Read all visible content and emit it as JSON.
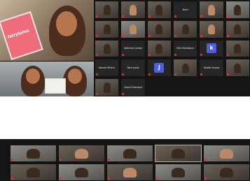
{
  "colors": {
    "tile_background": "#262626",
    "active_speaker_border": "#8fd14f",
    "avatar_blue": "#4e5ee0",
    "avatar_magenta": "#c93ad0"
  },
  "shot1": {
    "speaker_panel": {
      "book_title": "fairytales",
      "icon": "presenter-video"
    },
    "tiles": [
      {
        "type": "video",
        "name": "",
        "label": ""
      },
      {
        "type": "video",
        "name": "",
        "label": ""
      },
      {
        "type": "video",
        "name": "",
        "label": ""
      },
      {
        "type": "name",
        "name": "Neel",
        "label": ""
      },
      {
        "type": "video",
        "name": "",
        "label": ""
      },
      {
        "type": "video2",
        "name": "",
        "label": ""
      },
      {
        "type": "video",
        "name": "",
        "label": ""
      },
      {
        "type": "video2",
        "name": "",
        "label": ""
      },
      {
        "type": "video",
        "name": "",
        "label": ""
      },
      {
        "type": "video",
        "name": "",
        "label": ""
      },
      {
        "type": "video",
        "name": "",
        "label": ""
      },
      {
        "type": "video",
        "name": "",
        "label": ""
      },
      {
        "type": "video",
        "name": "",
        "label": ""
      },
      {
        "type": "name",
        "name": "Vaibhavi Jadav",
        "label": ""
      },
      {
        "type": "video",
        "name": "",
        "label": ""
      },
      {
        "type": "name",
        "name": "Mini Sarbajan",
        "label": ""
      },
      {
        "type": "avatar",
        "letter": "k",
        "color": "#4e5ee0",
        "label": ""
      },
      {
        "type": "video",
        "name": "",
        "label": ""
      },
      {
        "type": "name",
        "name": "Komal Mistry",
        "label": ""
      },
      {
        "type": "name",
        "name": "Tara ayda",
        "label": ""
      },
      {
        "type": "avatar",
        "letter": "J",
        "color": "#4e5ee0",
        "label": ""
      },
      {
        "type": "video",
        "name": "",
        "label": ""
      },
      {
        "type": "name",
        "name": "Nadia Sousa",
        "label": ""
      },
      {
        "type": "video",
        "name": "",
        "label": ""
      },
      {
        "type": "video",
        "name": "",
        "label": ""
      },
      {
        "type": "name",
        "name": "Aisani Nanapa",
        "label": ""
      }
    ]
  },
  "shot2": {
    "tiles": [
      {
        "type": "video2",
        "name": "",
        "label": ""
      },
      {
        "type": "video",
        "name": "",
        "label": ""
      },
      {
        "type": "video2",
        "name": "",
        "label": ""
      },
      {
        "type": "video",
        "name": "",
        "label": "",
        "active": true
      },
      {
        "type": "video2",
        "name": "",
        "label": ""
      },
      {
        "type": "video",
        "name": "",
        "label": ""
      },
      {
        "type": "video2",
        "name": "",
        "label": ""
      },
      {
        "type": "video",
        "name": "",
        "label": ""
      },
      {
        "type": "video2",
        "name": "",
        "label": ""
      },
      {
        "type": "video",
        "name": "",
        "label": ""
      }
    ]
  }
}
